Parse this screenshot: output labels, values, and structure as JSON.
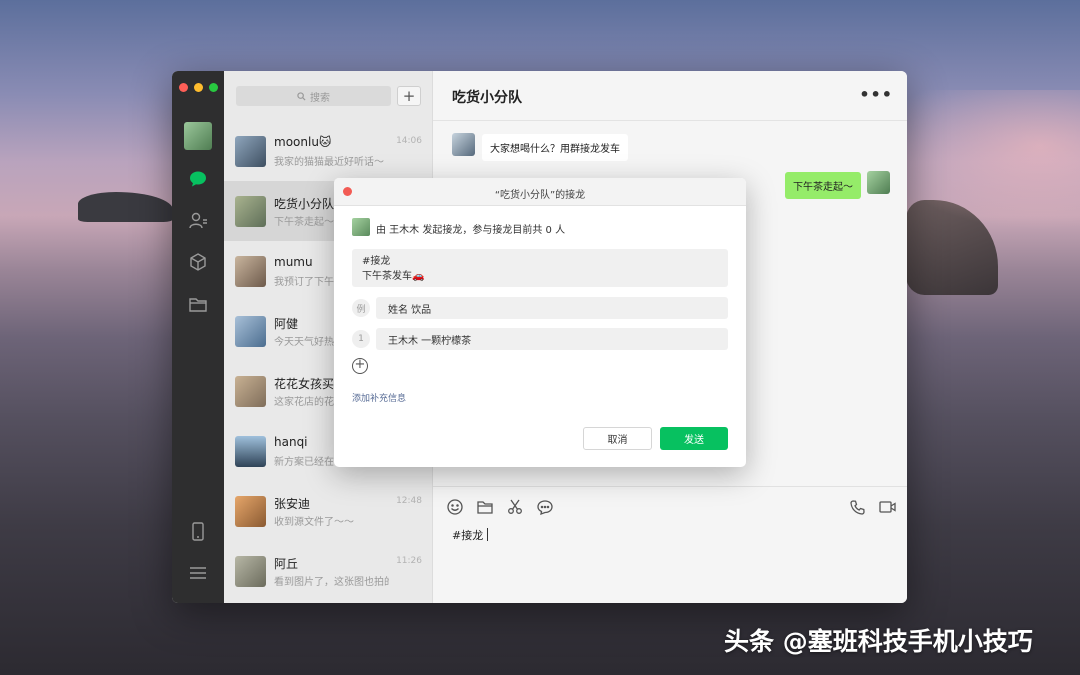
{
  "sidebar": {
    "icons": [
      "chat-icon",
      "contacts-icon",
      "favorites-icon",
      "files-icon",
      "phone-icon",
      "menu-icon"
    ],
    "accent": "#07c160"
  },
  "search": {
    "placeholder": "搜索"
  },
  "chats": [
    {
      "name": "moonlu🐱",
      "preview": "我家的猫猫最近好听话～",
      "time": "14:06",
      "color": "#5a6f86"
    },
    {
      "name": "吃货小分队",
      "preview": "下午茶走起～",
      "time": "",
      "color": "#7d8a6e"
    },
    {
      "name": "mumu",
      "preview": "我预订了下午",
      "time": "",
      "color": "#8a7a6a"
    },
    {
      "name": "阿健",
      "preview": "今天天气好热",
      "time": "",
      "color": "#6a87a6"
    },
    {
      "name": "花花女孩买衣服",
      "preview": "这家花店的花",
      "time": "",
      "color": "#9a8470"
    },
    {
      "name": "hanqi",
      "preview": "新方案已经在",
      "time": "",
      "color": "#4f6d8a"
    },
    {
      "name": "张安迪",
      "preview": "收到源文件了～～",
      "time": "12:48",
      "color": "#c48855"
    },
    {
      "name": "阿丘",
      "preview": "看到图片了，这张图也拍的...",
      "time": "11:26",
      "color": "#8a8a7a"
    }
  ],
  "chat": {
    "title": "吃货小分队",
    "messages": [
      {
        "side": "left",
        "text": "大家想喝什么？用群接龙发车"
      },
      {
        "side": "right",
        "text": "下午茶走起～"
      }
    ],
    "draft": "#接龙"
  },
  "dialog": {
    "title": "“吃货小分队”的接龙",
    "starter_text": "由 王木木 发起接龙，参与接龙目前共 0 人",
    "topic_line1": "#接龙",
    "topic_line2": "下午茶发车🚗",
    "example_label": "例",
    "example_text": "姓名 饮品",
    "entry_number": "1",
    "entry_text": "王木木 一颗柠檬茶",
    "add_info_label": "添加补充信息",
    "cancel_label": "取消",
    "send_label": "发送"
  },
  "watermark": "头条 @塞班科技手机小技巧"
}
